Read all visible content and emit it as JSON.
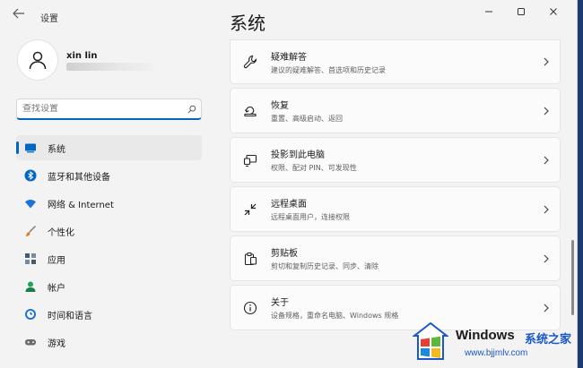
{
  "window": {
    "title": "设置"
  },
  "user": {
    "name": "xin lin"
  },
  "search": {
    "placeholder": "查找设置"
  },
  "sidebar": {
    "items": [
      {
        "label": "系统",
        "icon": "system-icon",
        "color": "#0067c0"
      },
      {
        "label": "蓝牙和其他设备",
        "icon": "bluetooth-icon",
        "color": "#0067c0"
      },
      {
        "label": "网络 & Internet",
        "icon": "wifi-icon",
        "color": "#1a73d9"
      },
      {
        "label": "个性化",
        "icon": "brush-icon",
        "color": "#d9802b"
      },
      {
        "label": "应用",
        "icon": "apps-icon",
        "color": "#4a5a6e"
      },
      {
        "label": "帐户",
        "icon": "account-icon",
        "color": "#22a35a"
      },
      {
        "label": "时间和语言",
        "icon": "clock-globe-icon",
        "color": "#1a73d9"
      },
      {
        "label": "游戏",
        "icon": "gamepad-icon",
        "color": "#6b6b6b"
      }
    ]
  },
  "main": {
    "title": "系统",
    "cards": [
      {
        "title": "疑难解答",
        "subtitle": "建议的疑难解答、首选项和历史记录",
        "icon": "wrench-icon"
      },
      {
        "title": "恢复",
        "subtitle": "重置、高级启动、返回",
        "icon": "recovery-icon"
      },
      {
        "title": "投影到此电脑",
        "subtitle": "权限、配对 PIN、可发现性",
        "icon": "projection-icon"
      },
      {
        "title": "远程桌面",
        "subtitle": "远程桌面用户，连接权限",
        "icon": "remote-desktop-icon"
      },
      {
        "title": "剪贴板",
        "subtitle": "剪切和复制历史记录、同步、清除",
        "icon": "clipboard-icon"
      },
      {
        "title": "关于",
        "subtitle": "设备规格，重命名电脑、Windows 规格",
        "icon": "info-icon"
      }
    ]
  },
  "watermark": {
    "brand": "Windows",
    "site_name": "系统之家",
    "url": "www.bjjmlv.com"
  },
  "colors": {
    "accent": "#0067c0",
    "background": "#f3f3f3",
    "card": "#fbfbfb"
  }
}
